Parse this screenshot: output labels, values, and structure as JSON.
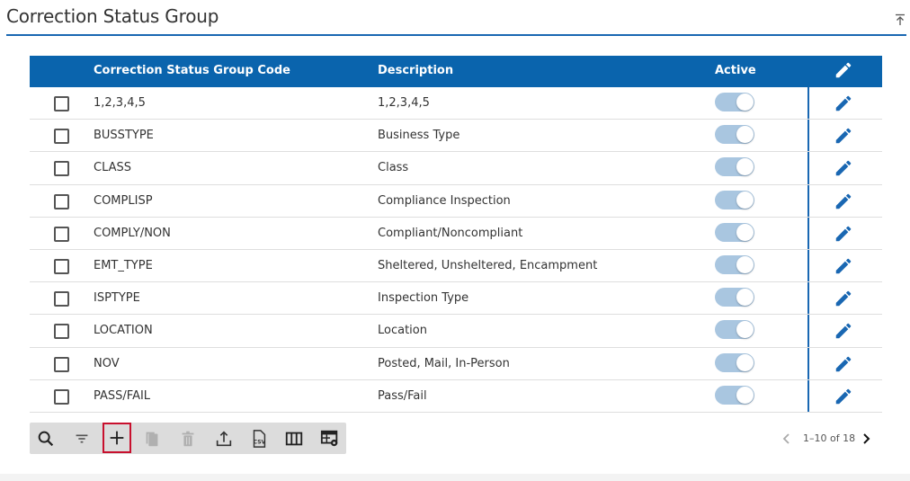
{
  "page": {
    "title": "Correction Status Group"
  },
  "table": {
    "columns": {
      "code": "Correction Status Group Code",
      "description": "Description",
      "active": "Active"
    },
    "rows": [
      {
        "code": "1,2,3,4,5",
        "description": "1,2,3,4,5",
        "active": true
      },
      {
        "code": "BUSSTYPE",
        "description": "Business Type",
        "active": true
      },
      {
        "code": "CLASS",
        "description": "Class",
        "active": true
      },
      {
        "code": "COMPLISP",
        "description": "Compliance Inspection",
        "active": true
      },
      {
        "code": "COMPLY/NON",
        "description": "Compliant/Noncompliant",
        "active": true
      },
      {
        "code": "EMT_TYPE",
        "description": "Sheltered, Unsheltered, Encampment",
        "active": true
      },
      {
        "code": "ISPTYPE",
        "description": "Inspection Type",
        "active": true
      },
      {
        "code": "LOCATION",
        "description": "Location",
        "active": true
      },
      {
        "code": "NOV",
        "description": "Posted, Mail, In-Person",
        "active": true
      },
      {
        "code": "PASS/FAIL",
        "description": "Pass/Fail",
        "active": true
      }
    ]
  },
  "toolbar": {
    "icons": [
      "search-icon",
      "filter-icon",
      "add-icon",
      "copy-icon",
      "delete-icon",
      "upload-icon",
      "csv-icon",
      "columns-icon",
      "table-settings-icon"
    ],
    "selected": "add-icon"
  },
  "pagination": {
    "range": "1–10 of 18"
  },
  "colors": {
    "header_bg": "#0a64ad",
    "accent": "#1967b2",
    "toggle_active": "#a9c6e0",
    "selected_outline": "#c8102e"
  }
}
